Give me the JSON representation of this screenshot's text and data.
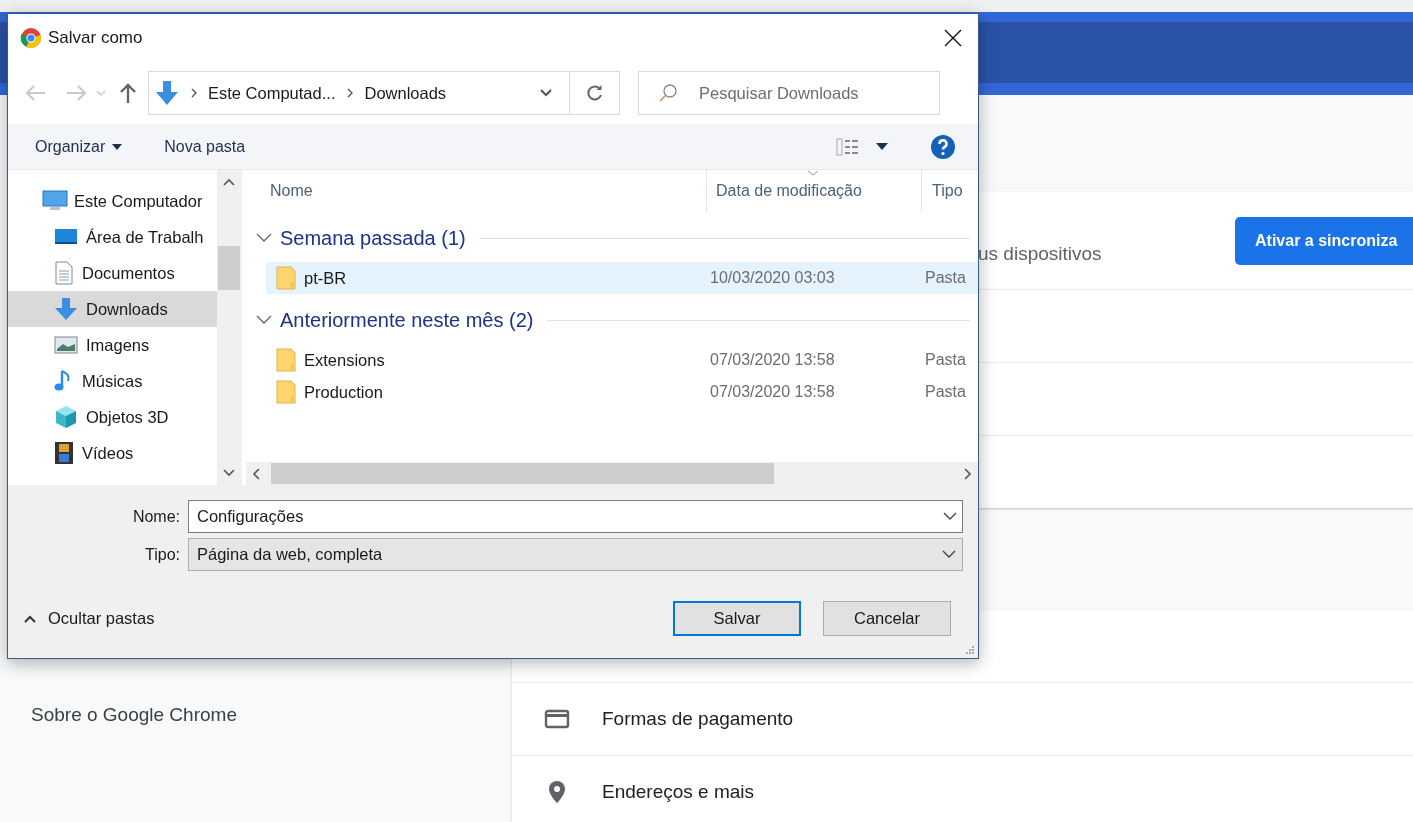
{
  "browser": {
    "sidebar_items": [
      {
        "label": "Sobre o Google Chrome"
      }
    ],
    "sync_text": "us dispositivos",
    "sync_button": "Ativar a sincroniza",
    "rows": [
      {
        "kind": "card",
        "label": "Formas de pagamento"
      },
      {
        "kind": "pin",
        "label": "Endereços e mais"
      }
    ]
  },
  "dialog": {
    "title": "Salvar como",
    "breadcrumb": [
      "Este Computad...",
      "Downloads"
    ],
    "search": {
      "placeholder": "Pesquisar Downloads"
    },
    "toolbar": {
      "organize": "Organizar",
      "new_folder": "Nova pasta"
    },
    "nav": [
      {
        "kind": "computer",
        "label": "Este Computador",
        "selected": false,
        "children": [
          {
            "kind": "desktop",
            "label": "Área de Trabalh",
            "selected": false
          },
          {
            "kind": "documents",
            "label": "Documentos",
            "selected": false
          },
          {
            "kind": "downloads",
            "label": "Downloads",
            "selected": true
          },
          {
            "kind": "pictures",
            "label": "Imagens",
            "selected": false
          },
          {
            "kind": "music",
            "label": "Músicas",
            "selected": false
          },
          {
            "kind": "objects3d",
            "label": "Objetos 3D",
            "selected": false
          },
          {
            "kind": "videos",
            "label": "Vídeos",
            "selected": false
          }
        ]
      }
    ],
    "columns": [
      "Nome",
      "Data de modificação",
      "Tipo"
    ],
    "groups": [
      {
        "title": "Semana passada (1)",
        "expanded": true,
        "files": [
          {
            "name": "pt-BR",
            "date": "10/03/2020 03:03",
            "type": "Pasta",
            "selected": true
          }
        ]
      },
      {
        "title": "Anteriormente neste mês (2)",
        "expanded": true,
        "files": [
          {
            "name": "Extensions",
            "date": "07/03/2020 13:58",
            "type": "Pasta",
            "selected": false
          },
          {
            "name": "Production",
            "date": "07/03/2020 13:58",
            "type": "Pasta",
            "selected": false
          }
        ]
      }
    ],
    "filename_label": "Nome:",
    "filename": "Configurações",
    "type_label": "Tipo:",
    "type_value": "Página da web, completa",
    "hide_folders": "Ocultar pastas",
    "buttons": [
      "Salvar",
      "Cancelar"
    ]
  }
}
